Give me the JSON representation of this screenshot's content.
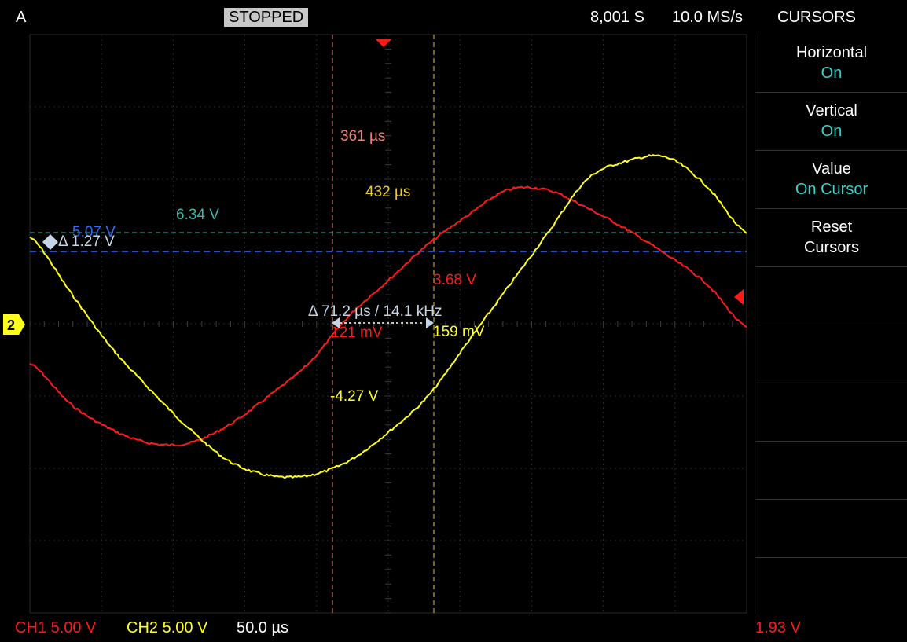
{
  "top_bar": {
    "trigger_label": "A",
    "status": "STOPPED",
    "sample_count": "8,001 S",
    "sample_rate": "10.0 MS/s",
    "menu_title": "CURSORS"
  },
  "side_menu": {
    "items": [
      {
        "label": "Horizontal",
        "value": "On"
      },
      {
        "label": "Vertical",
        "value": "On"
      },
      {
        "label": "Value",
        "value": "On Cursor"
      },
      {
        "label": "Reset",
        "value": "Cursors"
      }
    ]
  },
  "cursors": {
    "time1": "361 µs",
    "time2": "432 µs",
    "v_upper": "6.34 V",
    "v_lower": "5.07 V",
    "v_delta": "Δ 1.27 V",
    "t_delta": "Δ 71.2 µs / 14.1 kHz",
    "ch1_at_c1": "121 mV",
    "ch1_at_c2": "3.68 V",
    "ch2_at_c1": "-4.27 V",
    "ch2_at_c2": "159 mV"
  },
  "bottom_bar": {
    "ch1_scale": "CH1 5.00 V",
    "ch2_scale": "CH2 5.00 V",
    "timebase": "50.0 µs",
    "trigger_level": "1.93 V"
  },
  "channel_marker": "2",
  "colors": {
    "ch1": "#ff1a1a",
    "ch2": "#ffff1a",
    "cursor1": "#f08070",
    "cursor2": "#e8c92a",
    "hcursor_upper": "#3ab8a8",
    "hcursor_lower": "#2f6ff0",
    "accent": "#3ad1c9"
  },
  "chart_data": {
    "type": "line",
    "x": [
      -400,
      -350,
      -300,
      -250,
      -200,
      -150,
      -100,
      -50,
      0,
      50,
      100,
      150,
      200,
      250,
      300,
      350,
      400,
      450,
      500
    ],
    "series": [
      {
        "values": [
          -0.55,
          -1.1,
          -1.45,
          -1.65,
          -1.65,
          -1.4,
          -1.0,
          -0.55,
          0.1,
          0.6,
          1.1,
          1.5,
          1.85,
          1.85,
          1.6,
          1.3,
          0.95,
          0.55,
          -0.05
        ]
      },
      {
        "values": [
          1.2,
          0.45,
          -0.3,
          -0.9,
          -1.45,
          -1.9,
          -2.1,
          -2.1,
          -1.9,
          -1.5,
          -1.0,
          -0.25,
          0.5,
          1.25,
          2.0,
          2.25,
          2.3,
          1.9,
          1.25
        ]
      }
    ],
    "ylim": [
      -4,
      4
    ]
  }
}
